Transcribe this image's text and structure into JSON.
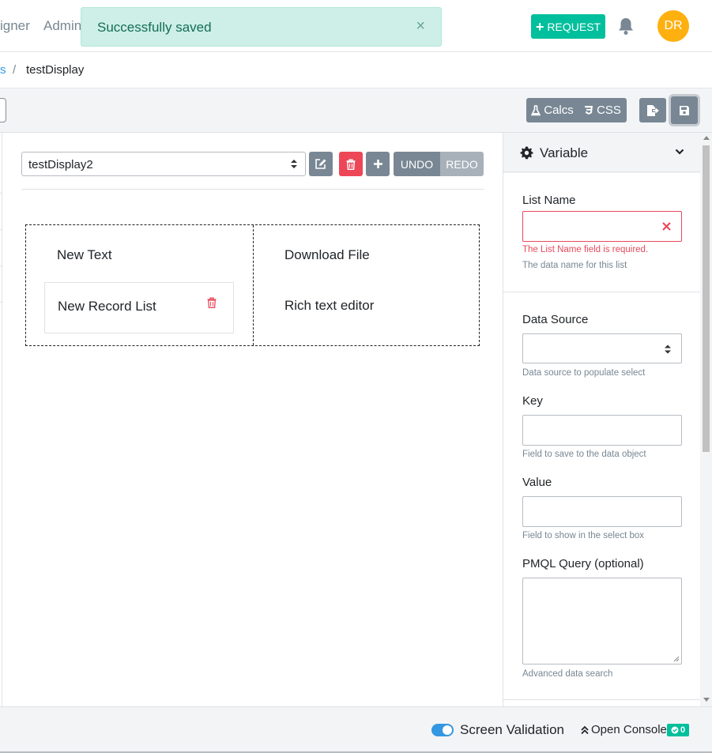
{
  "nav": {
    "link_designer": "igner",
    "link_admin": "Admin",
    "request_label": "REQUEST",
    "avatar_initials": "DR",
    "accent": "#00bf9c",
    "avatar_color": "#fdb00f"
  },
  "toast": {
    "message": "Successfully saved",
    "close": "×"
  },
  "breadcrumb": {
    "prev": "s",
    "separator": "/",
    "current": "testDisplay"
  },
  "toolbar": {
    "calcs_label": "Calcs",
    "css_label": "CSS",
    "export_icon": "export-icon",
    "save_icon": "save-icon"
  },
  "editor": {
    "page_select_value": "testDisplay2",
    "undo_label": "UNDO",
    "redo_label": "REDO",
    "cells": {
      "new_text": "New Text",
      "new_record_list": "New Record List",
      "download_file": "Download File",
      "rich_text_editor": "Rich text editor"
    }
  },
  "inspector": {
    "title": "Variable",
    "list_name": {
      "label": "List Name",
      "value": "",
      "error": "The List Name field is required.",
      "help": "The data name for this list"
    },
    "data_source": {
      "label": "Data Source",
      "value": "",
      "help": "Data source to populate select"
    },
    "key": {
      "label": "Key",
      "value": "",
      "help": "Field to save to the data object"
    },
    "value": {
      "label": "Value",
      "value": "",
      "help": "Field to show in the select box"
    },
    "pmql": {
      "label": "PMQL Query (optional)",
      "value": "",
      "help": "Advanced data search"
    }
  },
  "footer": {
    "screen_validation": "Screen Validation",
    "screen_validation_on": true,
    "open_console": "Open Console",
    "console_count": "0"
  }
}
